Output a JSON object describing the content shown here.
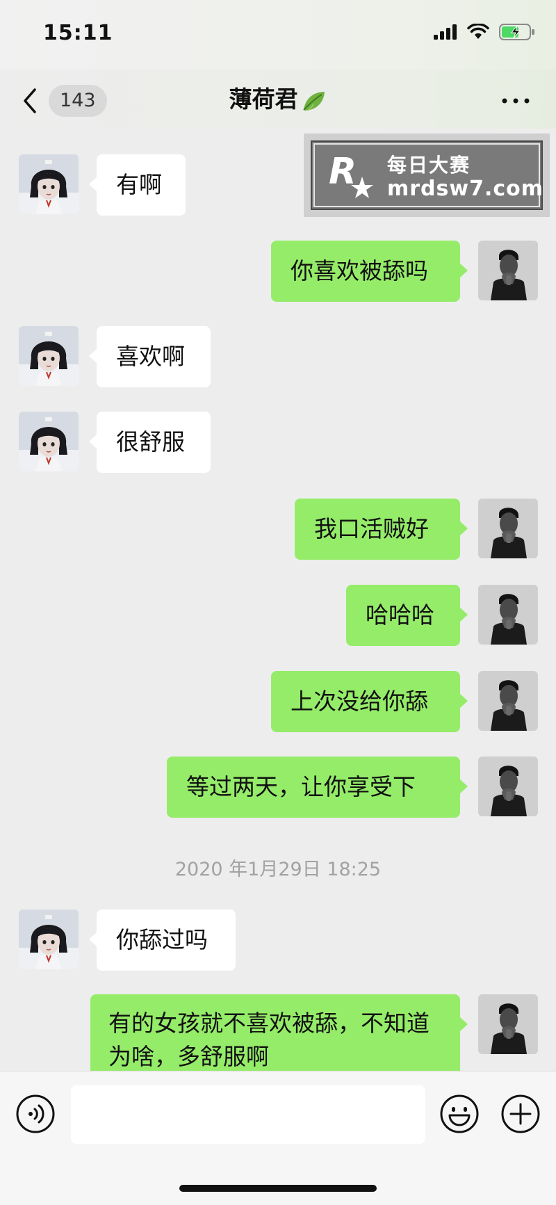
{
  "status_bar": {
    "time": "15:11",
    "icons": [
      "signal-icon",
      "wifi-icon",
      "battery-charging-icon"
    ]
  },
  "nav": {
    "back_icon": "chevron-left-icon",
    "unread_count": "143",
    "title": "薄荷君",
    "title_emoji": "leaf-icon",
    "more_icon": "more-dots-icon"
  },
  "watermark": {
    "logo_letter": "R",
    "title": "每日大赛",
    "url": "mrdsw7.com"
  },
  "messages": [
    {
      "side": "left",
      "text": "有啊"
    },
    {
      "side": "right",
      "text": "你喜欢被舔吗"
    },
    {
      "side": "left",
      "text": "喜欢啊"
    },
    {
      "side": "left",
      "text": "很舒服"
    },
    {
      "side": "right",
      "text": "我口活贼好"
    },
    {
      "side": "right",
      "text": "哈哈哈"
    },
    {
      "side": "right",
      "text": "上次没给你舔"
    },
    {
      "side": "right",
      "text": "等过两天，让你享受下"
    },
    {
      "side": "left",
      "text": "你舔过吗"
    },
    {
      "side": "right",
      "text": "有的女孩就不喜欢被舔，不知道为啥，多舒服啊"
    }
  ],
  "timestamp": "2020 年1月29日 18:25",
  "input_bar": {
    "voice_icon": "voice-icon",
    "input_value": "",
    "emoji_icon": "emoji-icon",
    "plus_icon": "plus-icon"
  },
  "colors": {
    "background": "#ededed",
    "bubble_sent": "#95ec69",
    "bubble_received": "#ffffff"
  }
}
